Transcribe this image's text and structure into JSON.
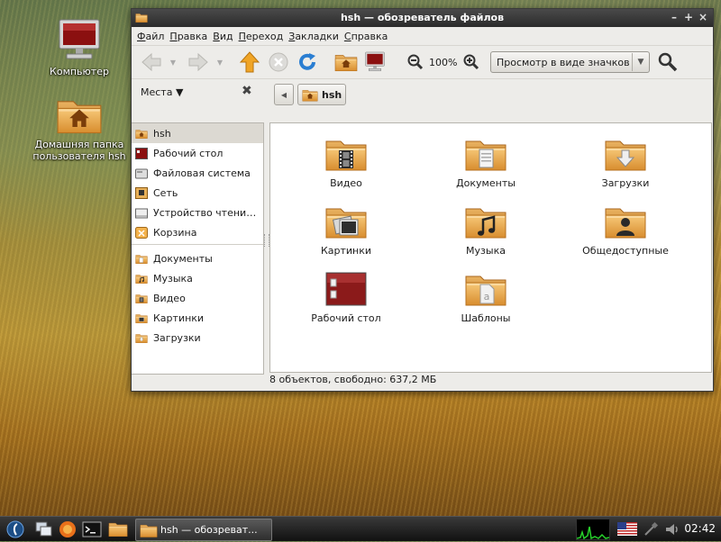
{
  "desktop": {
    "icons": [
      {
        "label": "Компьютер",
        "icon": "computer-icon"
      },
      {
        "label_line1": "Домашняя папка",
        "label_line2": "пользователя hsh",
        "icon": "home-folder-icon"
      }
    ]
  },
  "window": {
    "title": "hsh — обозреватель файлов",
    "controls": [
      "–",
      "+",
      "×"
    ]
  },
  "menu": [
    "Файл",
    "Правка",
    "Вид",
    "Переход",
    "Закладки",
    "Справка"
  ],
  "toolbar": {
    "zoom": "100%",
    "view_mode": "Просмотр в виде значков"
  },
  "places": {
    "header": "Места ▼",
    "close": "✖",
    "items": [
      {
        "label": "hsh",
        "icon": "home-icon",
        "selected": true
      },
      {
        "label": "Рабочий стол",
        "icon": "desktop-icon"
      },
      {
        "label": "Файловая система",
        "icon": "filesystem-icon"
      },
      {
        "label": "Сеть",
        "icon": "network-icon"
      },
      {
        "label": "Устройство чтени…",
        "icon": "drive-icon"
      },
      {
        "label": "Корзина",
        "icon": "trash-icon"
      }
    ],
    "bookmarks": [
      {
        "label": "Документы",
        "icon": "documents-folder-icon"
      },
      {
        "label": "Музыка",
        "icon": "music-folder-icon"
      },
      {
        "label": "Видео",
        "icon": "video-folder-icon"
      },
      {
        "label": "Картинки",
        "icon": "pictures-folder-icon"
      },
      {
        "label": "Загрузки",
        "icon": "downloads-folder-icon"
      }
    ]
  },
  "path": {
    "current": "hsh"
  },
  "files": [
    {
      "label": "Видео",
      "icon": "video-folder-icon"
    },
    {
      "label": "Документы",
      "icon": "documents-folder-icon"
    },
    {
      "label": "Загрузки",
      "icon": "downloads-folder-icon"
    },
    {
      "label": "Картинки",
      "icon": "pictures-folder-icon"
    },
    {
      "label": "Музыка",
      "icon": "music-folder-icon"
    },
    {
      "label": "Общедоступные",
      "icon": "public-folder-icon"
    },
    {
      "label": "Рабочий стол",
      "icon": "desktop-folder-icon"
    },
    {
      "label": "Шаблоны",
      "icon": "templates-folder-icon"
    }
  ],
  "status": "8 объектов, свободно: 637,2 МБ",
  "taskbar": {
    "active_task": "hsh — обозреват...",
    "clock": "02:42"
  }
}
